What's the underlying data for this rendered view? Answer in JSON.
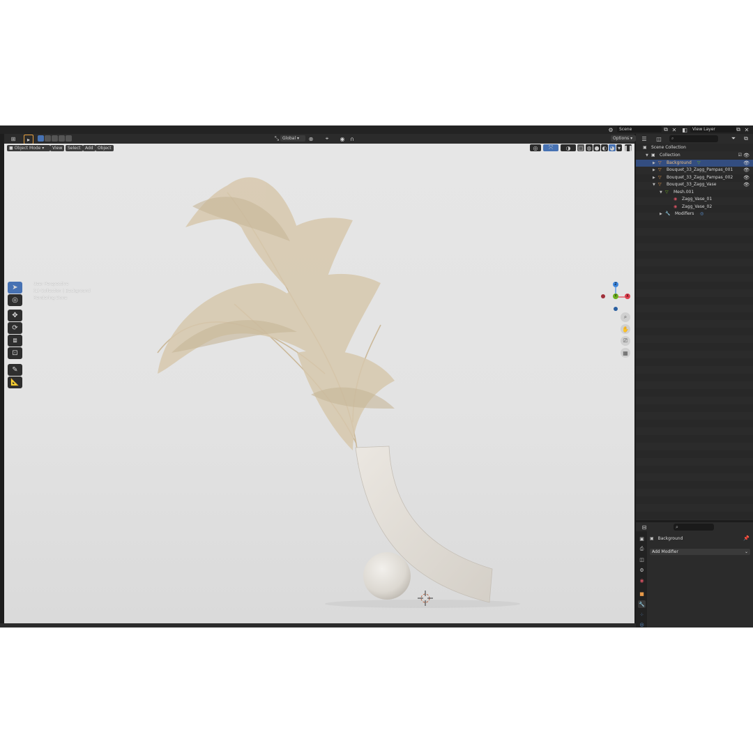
{
  "header": {
    "scene_label": "Scene",
    "view_layer_label": "View Layer"
  },
  "viewport_header": {
    "mode": "Object Mode",
    "menus": [
      "View",
      "Select",
      "Add",
      "Object"
    ],
    "orientation": "Global",
    "options_label": "Options"
  },
  "viewport_overlay": {
    "line1": "User Perspective",
    "line2": "(1) Collection | Background",
    "line3": "Rendering Done"
  },
  "gizmo": {
    "z": "Z",
    "y": "Y",
    "x": "X"
  },
  "outliner": {
    "search_placeholder": "",
    "scene_collection": "Scene Collection",
    "collection": "Collection",
    "items": [
      {
        "label": "Background"
      },
      {
        "label": "Bouquet_33_Zagg_Pampas_001"
      },
      {
        "label": "Bouquet_33_Zagg_Pampas_002"
      },
      {
        "label": "Bouquet_33_Zagg_Vase"
      },
      {
        "label": "Mesh.001"
      },
      {
        "label": "Zagg_Vase_01"
      },
      {
        "label": "Zagg_Vase_02"
      },
      {
        "label": "Modifiers"
      }
    ]
  },
  "properties": {
    "object_name": "Background",
    "add_modifier": "Add Modifier"
  },
  "icons": {
    "select": "cursor-arrow-icon",
    "cursor": "3d-cursor-icon",
    "move": "move-icon",
    "rotate": "rotate-icon",
    "scale": "scale-icon",
    "transform": "transform-icon",
    "annotate": "annotate-icon",
    "measure": "measure-icon"
  },
  "colors": {
    "selection": "#334d80",
    "active_tool": "#4772b3",
    "axis_x": "#e0404f",
    "axis_y": "#6db020",
    "axis_z": "#3e88e0",
    "mesh_icon": "#e89a4a"
  }
}
